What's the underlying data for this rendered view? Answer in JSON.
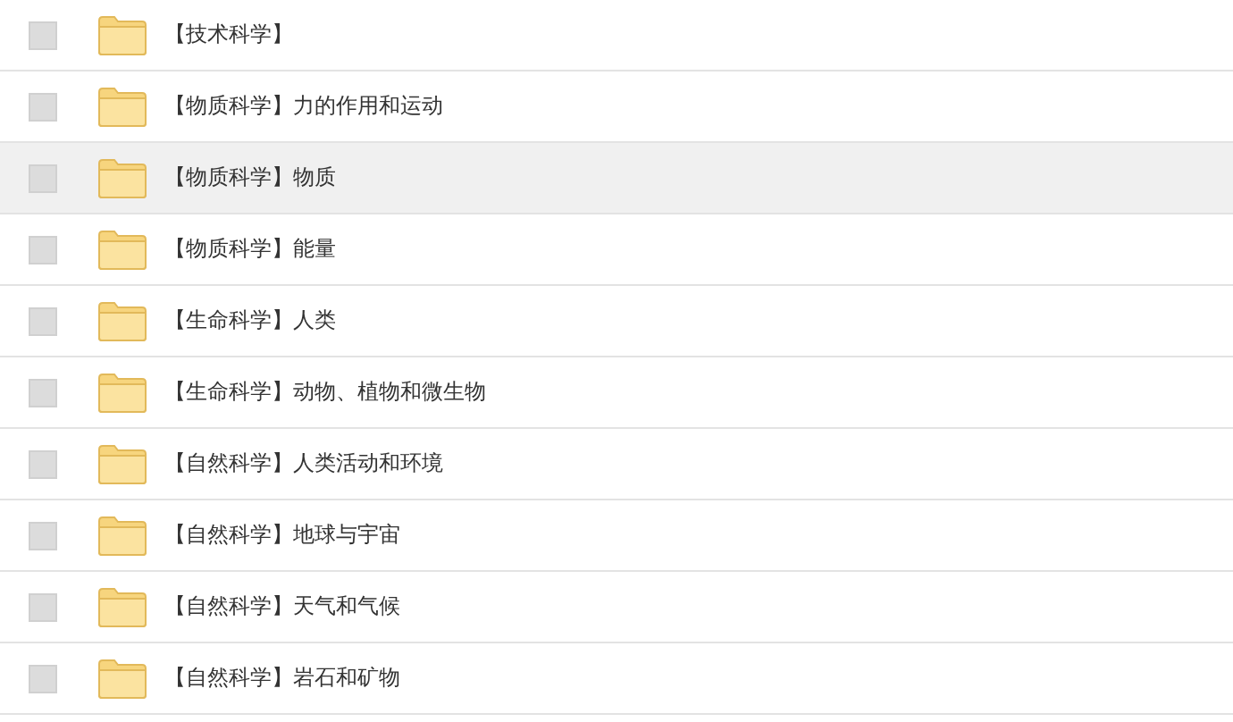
{
  "rows": [
    {
      "name": "【技术科学】",
      "checked": false,
      "highlighted": false
    },
    {
      "name": "【物质科学】力的作用和运动",
      "checked": false,
      "highlighted": false
    },
    {
      "name": "【物质科学】物质",
      "checked": false,
      "highlighted": true
    },
    {
      "name": "【物质科学】能量",
      "checked": false,
      "highlighted": false
    },
    {
      "name": "【生命科学】人类",
      "checked": false,
      "highlighted": false
    },
    {
      "name": "【生命科学】动物、植物和微生物",
      "checked": false,
      "highlighted": false
    },
    {
      "name": "【自然科学】人类活动和环境",
      "checked": false,
      "highlighted": false
    },
    {
      "name": "【自然科学】地球与宇宙",
      "checked": false,
      "highlighted": false
    },
    {
      "name": "【自然科学】天气和气候",
      "checked": false,
      "highlighted": false
    },
    {
      "name": "【自然科学】岩石和矿物",
      "checked": false,
      "highlighted": false
    }
  ]
}
